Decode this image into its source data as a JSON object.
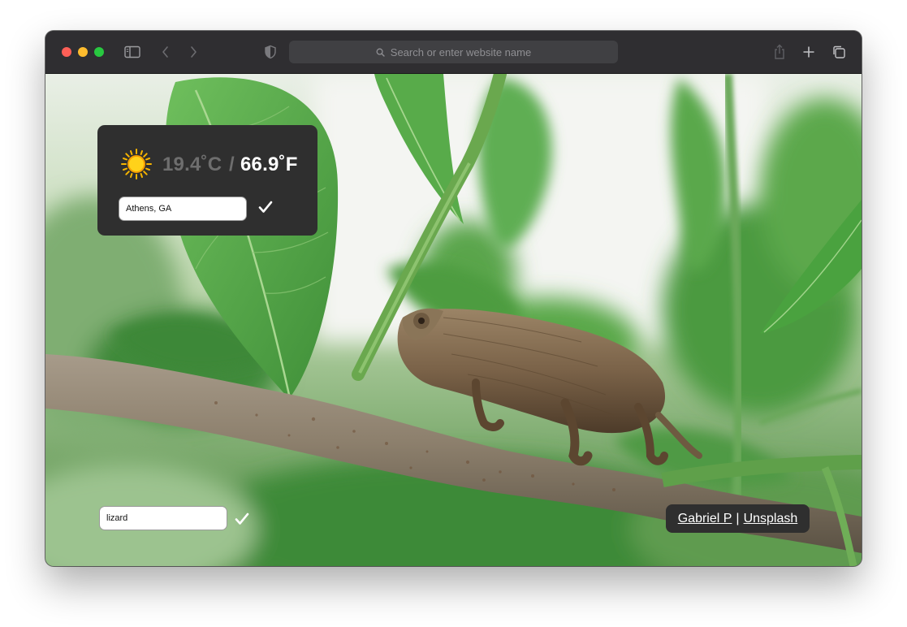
{
  "browser": {
    "address_placeholder": "Search or enter website name"
  },
  "weather": {
    "icon": "sun-icon",
    "celsius": "19.4˚C",
    "separator": "/",
    "fahrenheit": "66.9˚F",
    "location_value": "Athens, GA"
  },
  "search": {
    "keyword_value": "lizard"
  },
  "credit": {
    "author": "Gabriel P",
    "separator": "|",
    "source": "Unsplash"
  },
  "colors": {
    "card_bg": "#2f2f2f",
    "temp_dim": "#6e6e6e",
    "temp_bright": "#ffffff",
    "sun": "#f7b500"
  }
}
